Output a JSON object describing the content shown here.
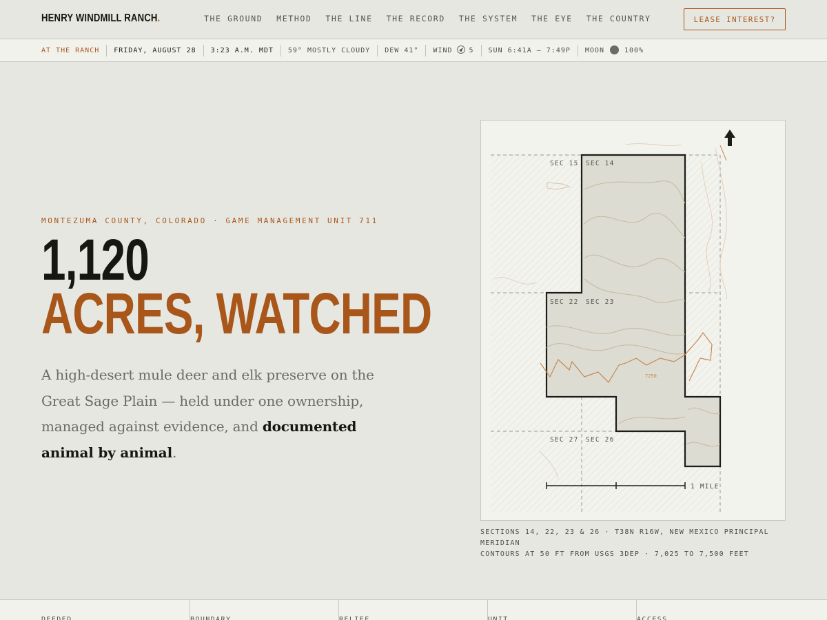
{
  "brand": {
    "name": "HENRY WINDMILL RANCH",
    "dot": "."
  },
  "nav": {
    "links": [
      "THE GROUND",
      "METHOD",
      "THE LINE",
      "THE RECORD",
      "THE SYSTEM",
      "THE EYE",
      "THE COUNTRY"
    ],
    "cta": "LEASE INTEREST?"
  },
  "status": {
    "label": "AT THE RANCH",
    "date": "FRIDAY, AUGUST 28",
    "time": "3:23 A.M. MDT",
    "weather": "59° MOSTLY CLOUDY",
    "dew": "DEW 41°",
    "wind_label": "WIND",
    "wind_value": "5",
    "sun": "SUN 6:41A – 7:49P",
    "moon_label": "MOON",
    "moon_value": "100%"
  },
  "hero": {
    "eyebrow": "MONTEZUMA COUNTY, COLORADO · GAME MANAGEMENT UNIT 711",
    "headline_number": "1,120",
    "headline_text": "ACRES, WATCHED",
    "lede_plain": "A high-desert mule deer and elk preserve on the Great Sage Plain — held under one ownership, managed against evidence, and ",
    "lede_bold": "documented animal by animal",
    "lede_end": "."
  },
  "map": {
    "section_labels": [
      "SEC 15",
      "SEC 14",
      "SEC 22",
      "SEC 23",
      "SEC 27",
      "SEC 26"
    ],
    "contour_label": "7250",
    "scale_label": "1 MILE",
    "accent_color": "#c8884f",
    "boundary_color": "#1c1d18"
  },
  "caption": {
    "line1": "SECTIONS 14, 22, 23 & 26 · T38N R16W, NEW MEXICO PRINCIPAL MERIDIAN",
    "line2": "CONTOURS AT 50 FT FROM USGS 3DEP · 7,025 TO 7,500 FEET"
  },
  "stats": [
    "DEEDED",
    "BOUNDARY",
    "RELIEF",
    "UNIT",
    "ACCESS"
  ],
  "colors": {
    "accent": "#a8561a",
    "ink": "#16170f",
    "background": "#e7e7e1"
  }
}
